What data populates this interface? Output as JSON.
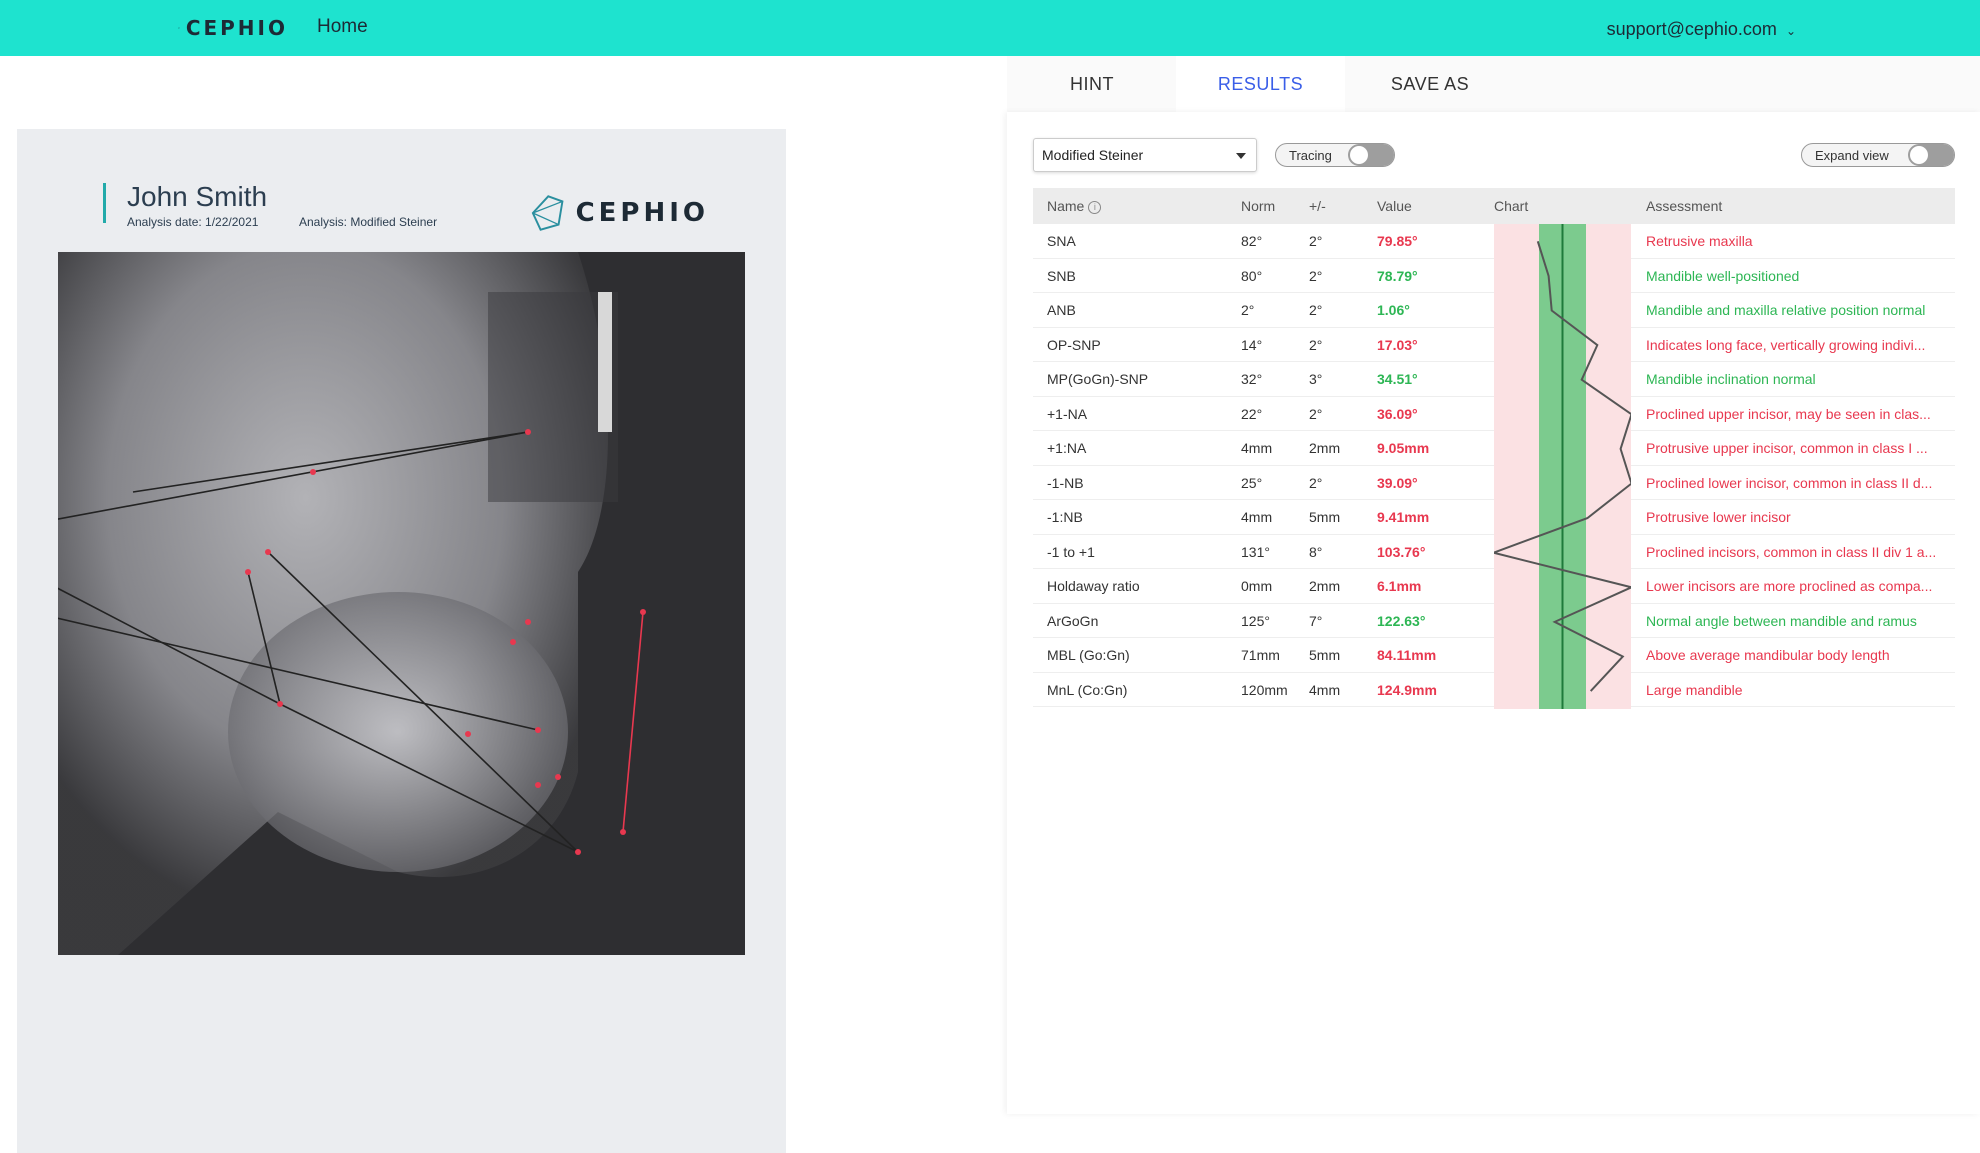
{
  "header": {
    "logo_text": "CEPHIO",
    "home_label": "Home",
    "user_email": "support@cephio.com"
  },
  "document": {
    "patient_name": "John Smith",
    "analysis_date": "Analysis date: 1/22/2021",
    "analysis_type": "Analysis: Modified Steiner",
    "logo_text": "CEPHIO"
  },
  "tabs": [
    {
      "label": "HINT",
      "active": false
    },
    {
      "label": "RESULTS",
      "active": true
    },
    {
      "label": "SAVE AS",
      "active": false
    }
  ],
  "controls": {
    "analysis_select": "Modified Steiner",
    "tracing_label": "Tracing",
    "tracing_on": false,
    "expand_label": "Expand view",
    "expand_on": false
  },
  "table": {
    "headers": {
      "name": "Name",
      "norm": "Norm",
      "pm": "+/-",
      "value": "Value",
      "chart": "Chart",
      "assessment": "Assessment"
    },
    "rows": [
      {
        "name": "SNA",
        "norm": "82°",
        "pm": "2°",
        "value": "79.85°",
        "status": "red",
        "assessment": "Retrusive maxilla"
      },
      {
        "name": "SNB",
        "norm": "80°",
        "pm": "2°",
        "value": "78.79°",
        "status": "green",
        "assessment": "Mandible well-positioned"
      },
      {
        "name": "ANB",
        "norm": "2°",
        "pm": "2°",
        "value": "1.06°",
        "status": "green",
        "assessment": "Mandible and maxilla relative position normal"
      },
      {
        "name": "OP-SNP",
        "norm": "14°",
        "pm": "2°",
        "value": "17.03°",
        "status": "red",
        "assessment": "Indicates long face, vertically growing indivi..."
      },
      {
        "name": "MP(GoGn)-SNP",
        "norm": "32°",
        "pm": "3°",
        "value": "34.51°",
        "status": "green",
        "assessment": "Mandible inclination normal"
      },
      {
        "name": "+1-NA",
        "norm": "22°",
        "pm": "2°",
        "value": "36.09°",
        "status": "red",
        "assessment": "Proclined upper incisor, may be seen in clas..."
      },
      {
        "name": "+1:NA",
        "norm": "4mm",
        "pm": "2mm",
        "value": "9.05mm",
        "status": "red",
        "assessment": "Protrusive upper incisor, common in class I ..."
      },
      {
        "name": "-1-NB",
        "norm": "25°",
        "pm": "2°",
        "value": "39.09°",
        "status": "red",
        "assessment": "Proclined lower incisor, common in class II d..."
      },
      {
        "name": "-1:NB",
        "norm": "4mm",
        "pm": "5mm",
        "value": "9.41mm",
        "status": "red",
        "assessment": "Protrusive lower incisor"
      },
      {
        "name": "-1 to +1",
        "norm": "131°",
        "pm": "8°",
        "value": "103.76°",
        "status": "red",
        "assessment": "Proclined incisors, common in class II div 1 a..."
      },
      {
        "name": "Holdaway ratio",
        "norm": "0mm",
        "pm": "2mm",
        "value": "6.1mm",
        "status": "red",
        "assessment": "Lower incisors are more proclined as compa..."
      },
      {
        "name": "ArGoGn",
        "norm": "125°",
        "pm": "7°",
        "value": "122.63°",
        "status": "green",
        "assessment": "Normal angle between mandible and ramus"
      },
      {
        "name": "MBL (Go:Gn)",
        "norm": "71mm",
        "pm": "5mm",
        "value": "84.11mm",
        "status": "red",
        "assessment": "Above average mandibular body length"
      },
      {
        "name": "MnL (Co:Gn)",
        "norm": "120mm",
        "pm": "4mm",
        "value": "124.9mm",
        "status": "red",
        "assessment": "Large mandible"
      }
    ]
  },
  "colors": {
    "header_bg": "#1ee3cf",
    "tab_active": "#3a5ee8",
    "red": "#e8384f",
    "green": "#2db654",
    "chart_red": "#fbe1e3",
    "chart_green": "#7ccb8e"
  },
  "icons": {
    "logo": "cephio-logo-icon",
    "caret": "caret-down-icon",
    "info": "info-icon"
  }
}
